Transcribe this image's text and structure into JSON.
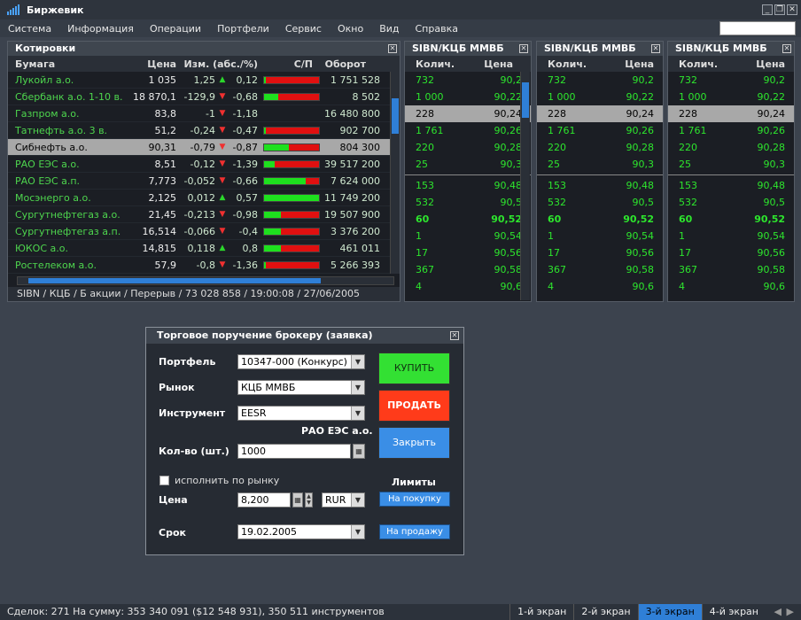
{
  "app": {
    "title": "Биржевик"
  },
  "menu": [
    "Система",
    "Информация",
    "Операции",
    "Портфели",
    "Сервис",
    "Окно",
    "Вид",
    "Справка"
  ],
  "quotes": {
    "title": "Котировки",
    "columns": [
      "Бумага",
      "Цена",
      "Изм. (абс./%)",
      "С/П",
      "Оборот"
    ],
    "rows": [
      {
        "name": "Лукойл а.о.",
        "price": "1 035",
        "abs": "1,25",
        "dir": "up",
        "pct": "0,12",
        "bar": 0.03,
        "vol": "1 751 528"
      },
      {
        "name": "Сбербанк а.о. 1-10 в.",
        "price": "18 870,1",
        "abs": "-129,9",
        "dir": "dn",
        "pct": "-0,68",
        "bar": 0.25,
        "vol": "8 502"
      },
      {
        "name": "Газпром а.о.",
        "price": "83,8",
        "abs": "-1",
        "dir": "dn",
        "pct": "-1,18",
        "bar": null,
        "vol": "16 480 800"
      },
      {
        "name": "Татнефть а.о. 3 в.",
        "price": "51,2",
        "abs": "-0,24",
        "dir": "dn",
        "pct": "-0,47",
        "bar": 0.03,
        "vol": "902 700"
      },
      {
        "name": "Сибнефть а.о.",
        "price": "90,31",
        "abs": "-0,79",
        "dir": "dn",
        "pct": "-0,87",
        "bar": 0.45,
        "vol": "804 300",
        "selected": true
      },
      {
        "name": "РАО ЕЭС а.о.",
        "price": "8,51",
        "abs": "-0,12",
        "dir": "dn",
        "pct": "-1,39",
        "bar": 0.2,
        "vol": "39 517 200"
      },
      {
        "name": "РАО ЕЭС а.п.",
        "price": "7,773",
        "abs": "-0,052",
        "dir": "dn",
        "pct": "-0,66",
        "bar": 0.75,
        "vol": "7 624 000"
      },
      {
        "name": "Мосэнерго а.о.",
        "price": "2,125",
        "abs": "0,012",
        "dir": "up",
        "pct": "0,57",
        "bar": 1,
        "vol": "11 749 200"
      },
      {
        "name": "Сургутнефтегаз а.о.",
        "price": "21,45",
        "abs": "-0,213",
        "dir": "dn",
        "pct": "-0,98",
        "bar": 0.3,
        "vol": "19 507 900"
      },
      {
        "name": "Сургутнефтегаз а.п.",
        "price": "16,514",
        "abs": "-0,066",
        "dir": "dn",
        "pct": "-0,4",
        "bar": 0.3,
        "vol": "3 376 200"
      },
      {
        "name": "ЮКОС а.о.",
        "price": "14,815",
        "abs": "0,118",
        "dir": "up",
        "pct": "0,8",
        "bar": 0.3,
        "vol": "461 011"
      },
      {
        "name": "Ростелеком а.о.",
        "price": "57,9",
        "abs": "-0,8",
        "dir": "dn",
        "pct": "-1,36",
        "bar": 0.03,
        "vol": "5 266 393"
      }
    ],
    "status": "SIBN / КЦБ / Б акции / Перерыв / 73 028 858 / 19:00:08 / 27/06/2005"
  },
  "orderbook": {
    "title": "SIBN/КЦБ ММВБ",
    "col_qty": "Колич.",
    "col_price": "Цена",
    "rows": [
      {
        "q": "732",
        "p": "90,2"
      },
      {
        "q": "1 000",
        "p": "90,22"
      },
      {
        "q": "228",
        "p": "90,24",
        "sel": true
      },
      {
        "q": "1 761",
        "p": "90,26"
      },
      {
        "q": "220",
        "p": "90,28"
      },
      {
        "q": "25",
        "p": "90,3"
      },
      {
        "q": "153",
        "p": "90,48",
        "sep": true
      },
      {
        "q": "532",
        "p": "90,5"
      },
      {
        "q": "60",
        "p": "90,52",
        "bold": true
      },
      {
        "q": "1",
        "p": "90,54"
      },
      {
        "q": "17",
        "p": "90,56"
      },
      {
        "q": "367",
        "p": "90,58"
      },
      {
        "q": "4",
        "p": "90,6"
      }
    ]
  },
  "dialog": {
    "title": "Торговое поручение брокеру (заявка)",
    "portfolio_label": "Портфель",
    "portfolio_value": "10347-000 (Конкурс)",
    "market_label": "Рынок",
    "market_value": "КЦБ ММВБ",
    "instrument_label": "Инструмент",
    "instrument_value": "EESR",
    "instrument_name": "РАО ЕЭС а.о.",
    "qty_label": "Кол-во (шт.)",
    "qty_value": "1000",
    "market_exec_label": "исполнить по рынку",
    "price_label": "Цена",
    "price_value": "8,200",
    "currency": "RUR",
    "term_label": "Срок",
    "term_value": "19.02.2005",
    "buy": "КУПИТЬ",
    "sell": "ПРОДАТЬ",
    "close": "Закрыть",
    "limits_label": "Лимиты",
    "limit_buy": "На покупку",
    "limit_sell": "На продажу",
    "colors": {
      "buy": "#33e033",
      "sell": "#ff3b1a",
      "close": "#3a8ee6"
    }
  },
  "footer": {
    "stats": "Сделок: 271 На сумму: 353 340 091 ($12 548 931), 350 511 инструментов",
    "tabs": [
      "1-й экран",
      "2-й экран",
      "3-й экран",
      "4-й экран"
    ],
    "active_tab": 2
  }
}
